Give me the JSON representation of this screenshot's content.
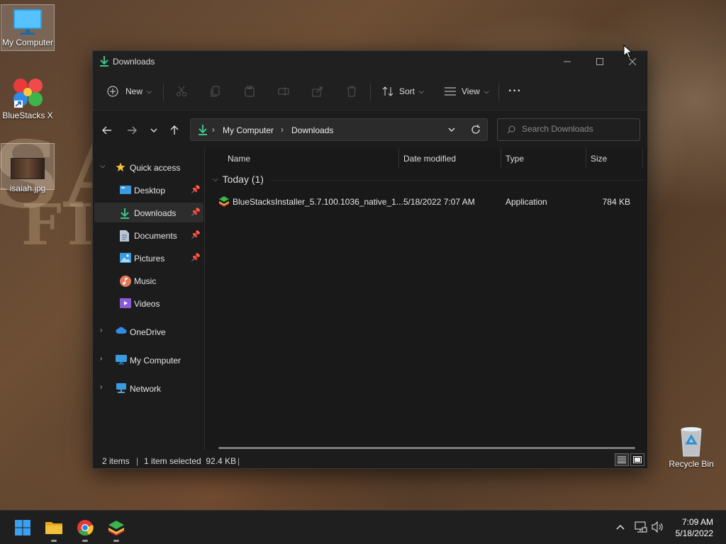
{
  "desktop": {
    "icons": [
      {
        "label": "My Computer"
      },
      {
        "label": "BlueStacks X"
      },
      {
        "label": "isaiah.jpg"
      },
      {
        "label": "Recycle Bin"
      }
    ]
  },
  "window": {
    "title": "Downloads",
    "controls": [
      "minimize",
      "maximize",
      "close"
    ]
  },
  "toolbar": {
    "new_label": "New",
    "sort_label": "Sort",
    "view_label": "View",
    "more_label": "···"
  },
  "address": {
    "crumbs": [
      "My Computer",
      "Downloads"
    ]
  },
  "search": {
    "placeholder": "Search Downloads"
  },
  "sidebar": {
    "quick_access": "Quick access",
    "items": [
      {
        "label": "Desktop",
        "pinned": true
      },
      {
        "label": "Downloads",
        "pinned": true,
        "active": true
      },
      {
        "label": "Documents",
        "pinned": true
      },
      {
        "label": "Pictures",
        "pinned": true
      },
      {
        "label": "Music",
        "pinned": false
      },
      {
        "label": "Videos",
        "pinned": false
      }
    ],
    "roots": [
      {
        "label": "OneDrive"
      },
      {
        "label": "My Computer"
      },
      {
        "label": "Network"
      }
    ]
  },
  "columns": [
    "Name",
    "Date modified",
    "Type",
    "Size"
  ],
  "groups": [
    {
      "label": "Today (1)"
    }
  ],
  "files": [
    {
      "name": "BlueStacksInstaller_5.7.100.1036_native_1...",
      "date": "5/18/2022 7:07 AM",
      "type": "Application",
      "size": "784 KB"
    }
  ],
  "status": {
    "items": "2 items",
    "selected": "1 item selected  92.4 KB"
  },
  "taskbar": {
    "time": "7:09 AM",
    "date": "5/18/2022"
  },
  "colors": {
    "accent": "#0078d4",
    "downloads_green": "#3fc28a",
    "folder_yellow": "#f3c13a"
  }
}
